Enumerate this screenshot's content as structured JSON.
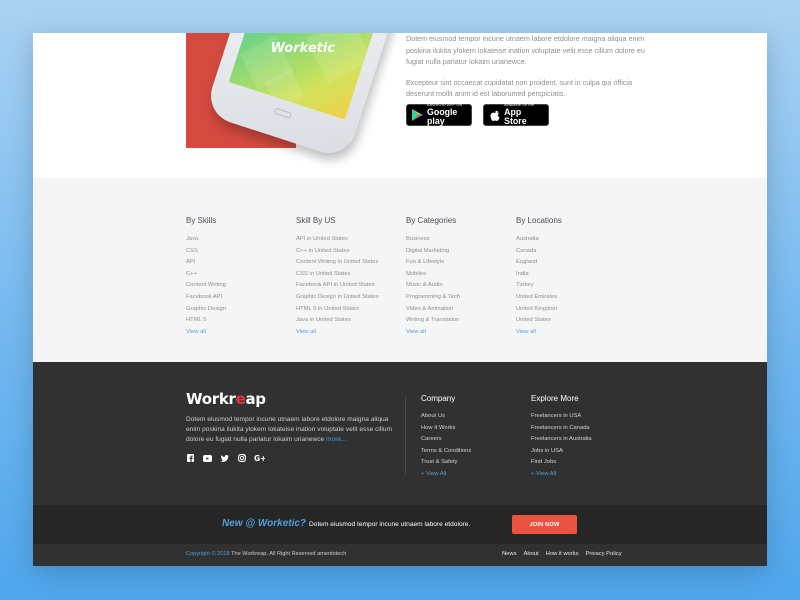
{
  "promo": {
    "phone_logo": "Worketic",
    "paragraph1": "Dotem eiusmod tempor incune utnaem labore etdolore maigna aliqua enim poskina ilukita ylokem lokateise ination voluptate velit esse cillum dolore eu fugiat nulla pariatur lokaim urianewce.",
    "paragraph2": "Excepteur sint occaecat cupidatat non proident, sunt in culpa qui officia deserunt mollit anim id est laborumed perspiciatis.",
    "google_play": {
      "small": "ANDROID APP ON",
      "big": "Google play"
    },
    "app_store": {
      "small": "Available on the",
      "big": "App Store"
    }
  },
  "categories": [
    {
      "title": "By Skills",
      "items": [
        "Java",
        "CSS",
        "API",
        "C++",
        "Content Writing",
        "Facebook API",
        "Graphic Design",
        "HTML 5"
      ],
      "view_all": "View all"
    },
    {
      "title": "Skill By US",
      "items": [
        "API in United States",
        "C++ in United States",
        "Content Writing in United States",
        "CSS in United States",
        "Facebook API in United States",
        "Graphic Design in United States",
        "HTML 5 in United States",
        "Java in United States"
      ],
      "view_all": "View all"
    },
    {
      "title": "By Categories",
      "items": [
        "Business",
        "Digital Marketing",
        "Fun & Lifestyle",
        "Mobiles",
        "Music & Audio",
        "Programming & Tech",
        "Video & Animation",
        "Writing & Translation"
      ],
      "view_all": "View all"
    },
    {
      "title": "By Locations",
      "items": [
        "Australia",
        "Canada",
        "England",
        "India",
        "Turkey",
        "United Emirates",
        "United Kingdom",
        "United States"
      ],
      "view_all": "View all"
    }
  ],
  "footer": {
    "brand_left": "Workr",
    "brand_mid": "e",
    "brand_right": "ap",
    "about": "Dotem eiusmod tempor incune utnaem labore etdolore maigna aliqua enim poskina ilukita ylokem lokateise ination voluptate velit esse cillum dolore eu fugiat nulla pariatur lokaim urianewce",
    "more": "more...",
    "company": {
      "title": "Company",
      "items": [
        "About Us",
        "How It Works",
        "Careers",
        "Terms & Conditions",
        "Trust & Safety"
      ],
      "view_all": "+ View All"
    },
    "explore": {
      "title": "Explore More",
      "items": [
        "Freelancers in USA",
        "Freelancers in Canada",
        "Freelancers in Australia",
        "Jobs in USA",
        "Find Jobs"
      ],
      "view_all": "+ View All"
    }
  },
  "cta": {
    "highlight": "New @ Worketic?",
    "text": "Dotem eiusmod tempor incune utnaem labore etdolore.",
    "button": "JOIN NOW"
  },
  "bottom": {
    "copyright_prefix": "Copyright © 2018",
    "copyright_rest": "The Workreap, All Right Reserved amentotech",
    "links": [
      "News",
      "About",
      "How it works",
      "Privacy Policy"
    ]
  },
  "colors": {
    "accent": "#4f9fe0",
    "brand_red": "#e53a3a",
    "cta_button": "#ec5242",
    "footer_bg": "#313131"
  },
  "icons": {
    "socials": [
      "facebook-icon",
      "youtube-icon",
      "twitter-icon",
      "instagram-icon",
      "google-plus-icon"
    ]
  }
}
